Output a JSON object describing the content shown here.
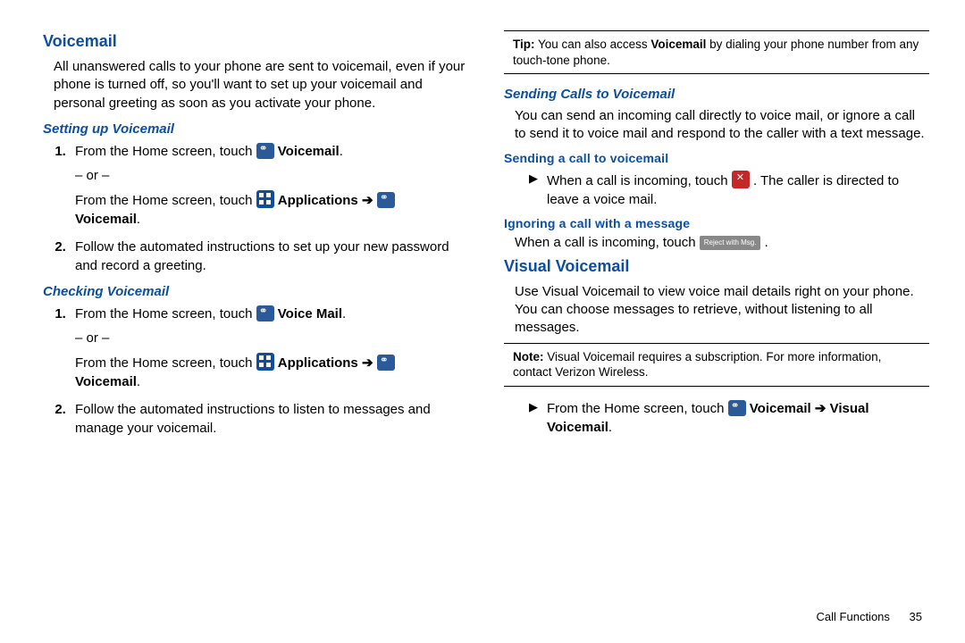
{
  "left": {
    "h1": "Voicemail",
    "intro": "All unanswered calls to your phone are sent to voicemail, even if your phone is turned off, so you'll want to set up your voicemail and personal greeting as soon as you activate your phone.",
    "setup_h": "Setting up Voicemail",
    "setup_1a": "From the Home screen, touch ",
    "setup_1b": " Voicemail",
    "or": "– or –",
    "setup_1c": "From the Home screen, touch ",
    "setup_1d": " Applications ➔ ",
    "setup_1e": " Voicemail",
    "setup_2": "Follow the automated instructions to set up your new password and record a greeting.",
    "check_h": "Checking Voicemail",
    "check_1a": "From the Home screen, touch ",
    "check_1b": " Voice Mail",
    "check_1c": "From the Home screen, touch ",
    "check_1d": " Applications ➔ ",
    "check_1e": " Voicemail",
    "check_2": "Follow the automated instructions to listen to messages and manage your voicemail."
  },
  "right": {
    "tip_label": "Tip:",
    "tip_a": " You can also access ",
    "tip_b": "Voicemail",
    "tip_c": " by dialing your phone number from any touch-tone phone.",
    "send_h": "Sending Calls to Voicemail",
    "send_p": "You can send an incoming call directly to voice mail, or ignore a call to send it to voice mail and respond to the caller with a text message.",
    "send_sub1": "Sending a call to voicemail",
    "send_sub1_a": "When a call is incoming, touch ",
    "send_sub1_b": " . The caller is directed to leave a voice mail.",
    "send_sub2": "Ignoring a call with a message",
    "send_sub2_a": "When a call is incoming, touch ",
    "reject_msg_label": "Reject with Msg.",
    "send_sub2_b": " .",
    "vv_h": "Visual Voicemail",
    "vv_p": "Use Visual Voicemail to view voice mail details right on your phone. You can choose messages to retrieve, without listening to all messages.",
    "note_label": "Note:",
    "note_a": " Visual Voicemail requires a subscription. For more information, contact Verizon Wireless.",
    "vv_step_a": "From the Home screen, touch ",
    "vv_step_b": " Voicemail ➔ Visual Voicemail",
    "footer_section": "Call Functions",
    "footer_page": "35"
  }
}
